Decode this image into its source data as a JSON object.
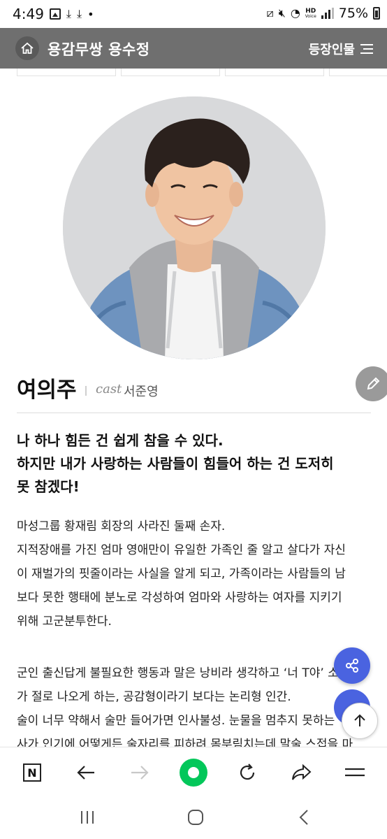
{
  "status": {
    "time": "4:49",
    "dot": "•",
    "hd_label": "HD",
    "voice_label": "Voice",
    "battery": "75%"
  },
  "header": {
    "title": "용감무쌍 용수정",
    "cast_menu_label": "등장인물"
  },
  "character": {
    "name": "여의주",
    "cast_label": "cast",
    "actor": "서준영"
  },
  "quote": [
    "나 하나 힘든 건 쉽게 참을 수 있다.",
    "하지만 내가 사랑하는 사람들이 힘들어 하는 건 도저히",
    "못 참겠다!"
  ],
  "description": [
    "마성그룹 황재림 회장의 사라진 둘째 손자.",
    "지적장애를 가진 엄마 영애만이 유일한 가족인 줄 알고 살다가 자신",
    "이 재벌가의 핏줄이라는 사실을 알게 되고, 가족이라는 사람들의 남",
    "보다 못한 행태에 분노로 각성하여 엄마와 사랑하는 여자를 지키기",
    "위해 고군분투한다."
  ],
  "description2": [
    "군인 출신답게 불필요한 행동과 말은 낭비라 생각하고 ‘너 T야’ 소리",
    "가 절로 나오게 하는, 공감형이라기 보다는 논리형 인간.",
    "술이 너무 약해서 술만 들어가면 인사불성. 눈물을 멈추지 못하는",
    "사가 인기에 어떻게든 술자리를 피하려 몸부림치는데 말술 스접을 마"
  ],
  "toolbar": {
    "n_label": "N"
  },
  "icons": {
    "home": "home-icon",
    "menu": "hamburger-icon",
    "edit": "pencil-icon",
    "share": "share-icon",
    "scroll_top": "arrow-up-icon",
    "back": "arrow-left-icon",
    "forward": "arrow-right-icon",
    "green_dot": "naver-green-icon",
    "reload": "reload-icon",
    "send": "share-arrow-icon",
    "more": "more-menu-icon"
  },
  "colors": {
    "header_bg": "#6f6f6f",
    "fab_blue": "#4a63e0",
    "green": "#03c75a"
  }
}
